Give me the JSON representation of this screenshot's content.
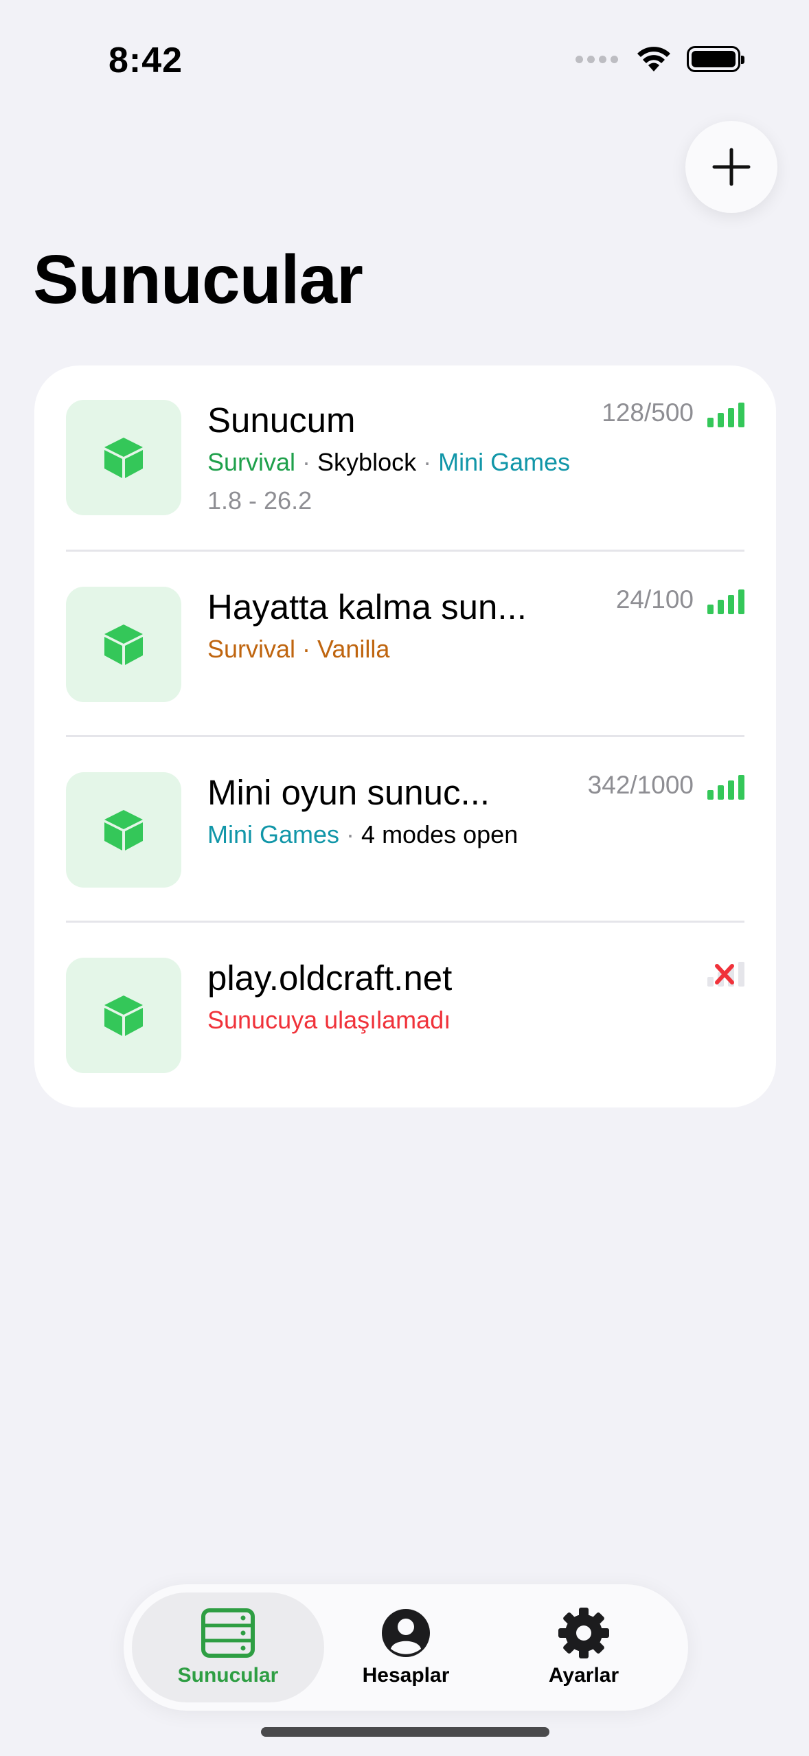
{
  "status_bar": {
    "time": "8:42"
  },
  "header": {
    "title": "Sunucular"
  },
  "servers": [
    {
      "name": "Sunucum",
      "tags": [
        {
          "text": "Survival",
          "color": "#1FA04B"
        },
        {
          "text": "Skyblock",
          "color": "#000000"
        },
        {
          "text": "Mini Games",
          "color": "#1196A8"
        }
      ],
      "version": "1.8 - 26.2",
      "players": "128/500",
      "status": "online"
    },
    {
      "name": "Hayatta kalma sun...",
      "tags": [
        {
          "text": "Survival",
          "color": "#BF650F"
        },
        {
          "text": "Vanilla",
          "color": "#BF650F"
        }
      ],
      "version": "",
      "players": "24/100",
      "status": "online"
    },
    {
      "name": "Mini oyun sunuc...",
      "tags": [
        {
          "text": "Mini Games",
          "color": "#1196A8"
        },
        {
          "text": "4 modes open",
          "color": "#000000"
        }
      ],
      "version": "",
      "players": "342/1000",
      "status": "online"
    },
    {
      "name": "play.oldcraft.net",
      "error": "Sunucuya ulaşılamadı",
      "status": "offline"
    }
  ],
  "tabbar": {
    "tabs": [
      {
        "label": "Sunucular",
        "icon": "server-rack-icon",
        "active": true
      },
      {
        "label": "Hesaplar",
        "icon": "person-circle-icon",
        "active": false
      },
      {
        "label": "Ayarlar",
        "icon": "gear-icon",
        "active": false
      }
    ]
  },
  "colors": {
    "accent": "#2E9E43",
    "signal": "#34C759",
    "error": "#F0323A"
  }
}
